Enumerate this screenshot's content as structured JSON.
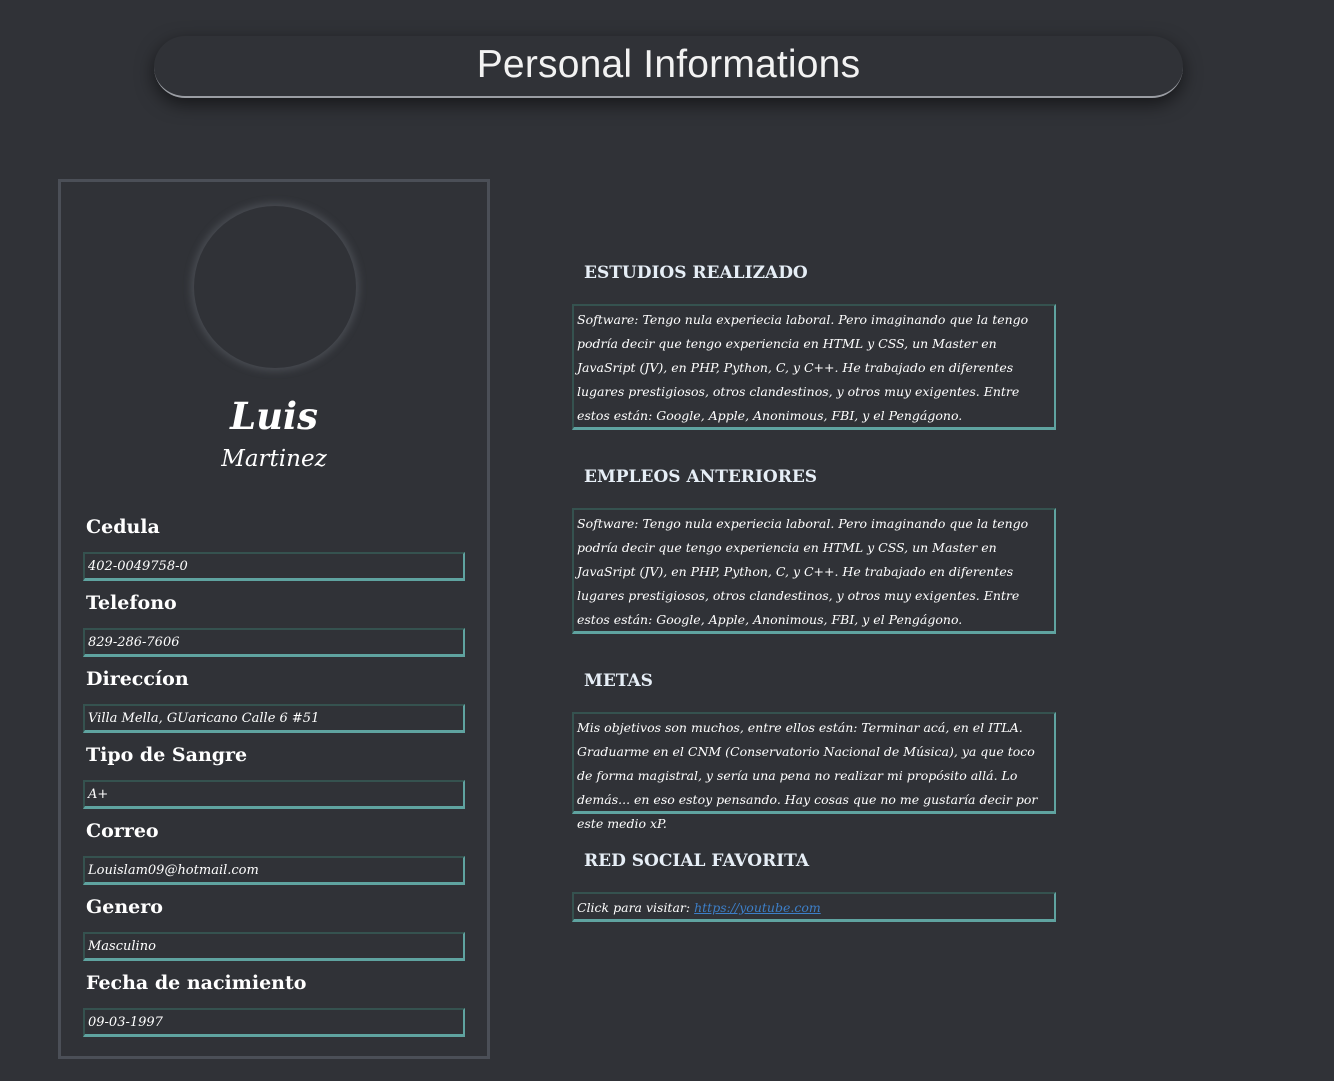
{
  "header": {
    "title": "Personal Informations"
  },
  "profile": {
    "first_name": "Luis",
    "last_name": "Martinez",
    "fields": [
      {
        "label": "Cedula",
        "value": "402-0049758-0"
      },
      {
        "label": "Telefono",
        "value": "829-286-7606"
      },
      {
        "label": "Direccíon",
        "value": "Villa Mella, GUaricano Calle 6 #51"
      },
      {
        "label": "Tipo de Sangre",
        "value": "A+"
      },
      {
        "label": "Correo",
        "value": "Louislam09@hotmail.com"
      },
      {
        "label": "Genero",
        "value": "Masculino"
      },
      {
        "label": "Fecha de nacimiento",
        "value": "09-03-1997"
      }
    ]
  },
  "sections": {
    "estudios": {
      "title": "ESTUDIOS REALIZADO",
      "text": "Software: Tengo nula experiecia laboral. Pero imaginando que la tengo podría decir que tengo experiencia en HTML y CSS, un Master en JavaSript (JV), en PHP, Python, C, y C++. He trabajado en diferentes lugares prestigiosos, otros clandestinos, y otros muy exigentes. Entre estos están: Google, Apple, Anonimous, FBI, y el Pengágono."
    },
    "empleos": {
      "title": "EMPLEOS ANTERIORES",
      "text": "Software: Tengo nula experiecia laboral. Pero imaginando que la tengo podría decir que tengo experiencia en HTML y CSS, un Master en JavaSript (JV), en PHP, Python, C, y C++. He trabajado en diferentes lugares prestigiosos, otros clandestinos, y otros muy exigentes. Entre estos están: Google, Apple, Anonimous, FBI, y el Pengágono."
    },
    "metas": {
      "title": "METAS",
      "text": "Mis objetivos son muchos, entre ellos están: Terminar acá, en el ITLA. Graduarme en el CNM (Conservatorio Nacional de Música), ya que toco de forma magistral, y sería una pena no realizar mi propósito allá. Lo demás... en eso estoy pensando. Hay cosas que no me gustaría decir por este medio xP."
    },
    "red_social": {
      "title": "RED SOCIAL FAVORITA",
      "prefix": "Click para visitar:",
      "link": "https://youtube.com"
    }
  },
  "colors": {
    "background": "#303237",
    "accent_teal": "#5fa3a0",
    "link_blue": "#3d7fc8"
  }
}
